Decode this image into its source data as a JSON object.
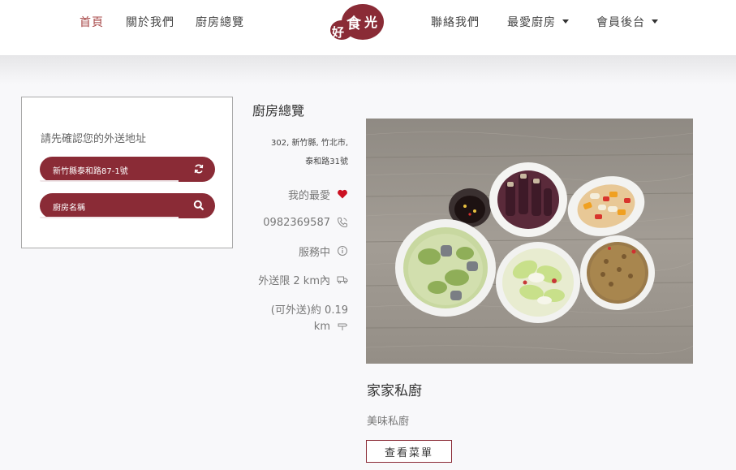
{
  "nav": {
    "home": "首頁",
    "about": "關於我們",
    "kitchens": "廚房總覽",
    "contact": "聯絡我們",
    "favorites": "最愛廚房",
    "member": "會員後台"
  },
  "logo": {
    "text": "好食光"
  },
  "search": {
    "title": "請先確認您的外送地址",
    "address_value": "新竹縣泰和路87-1號",
    "kitchen_placeholder": "廚房名稱"
  },
  "overview": {
    "title": "廚房總覽",
    "address_line1": "302, 新竹縣, 竹北市,",
    "address_line2": "泰和路31號",
    "favorite_label": "我的最愛",
    "phone": "0982369587",
    "status": "服務中",
    "delivery_limit": "外送限 2 km內",
    "distance_line1": "(可外送)約 0.19",
    "distance_line2": "km"
  },
  "restaurant": {
    "name": "家家私廚",
    "description": "美味私廚",
    "menu_button": "查看菜單"
  },
  "colors": {
    "brand": "#8a2b36",
    "active_nav": "#a84a4a",
    "heart": "#cc1122"
  }
}
